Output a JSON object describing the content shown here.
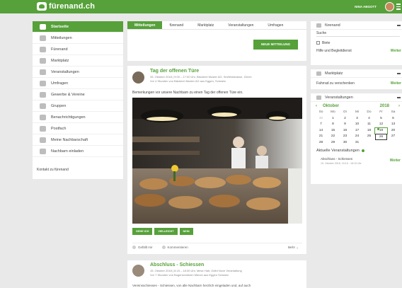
{
  "header": {
    "logo_text": "fürenand.ch",
    "user_name": "NINA ABGOTT"
  },
  "sidebar": {
    "items": [
      {
        "label": "Startseite",
        "icon": "home-icon",
        "active": true
      },
      {
        "label": "Mitteilungen",
        "icon": "speech-bubble-icon"
      },
      {
        "label": "Fürenand",
        "icon": "handshake-icon"
      },
      {
        "label": "Marktplatz",
        "icon": "tag-icon"
      },
      {
        "label": "Veranstaltungen",
        "icon": "calendar-icon"
      },
      {
        "label": "Umfragen",
        "icon": "poll-icon"
      },
      {
        "label": "Gewerbe & Vereine",
        "icon": "building-icon"
      },
      {
        "label": "Gruppen",
        "icon": "group-icon"
      },
      {
        "label": "Benachrichtigungen",
        "icon": "bell-icon"
      },
      {
        "label": "Postfach",
        "icon": "mail-icon"
      },
      {
        "label": "Meine Nachbarschaft",
        "icon": "house-icon"
      },
      {
        "label": "Nachbarn einladen",
        "icon": "invite-icon"
      }
    ],
    "contact": "Kontakt zu fürenand"
  },
  "composer": {
    "tabs": [
      "Mitteilungen",
      "fürenand",
      "Marktplatz",
      "Veranstaltungen",
      "Umfragen"
    ],
    "new_button": "NEUE MITTEILUNG"
  },
  "post1": {
    "title": "Tag der offenen Türe",
    "meta": "26. Oktober 2018 | 9:00 – 17:00 Uhr, Bäckerei Muster AG, Seefeldstrasse, Zürich",
    "meta2": "Vor 4 Stunden von Bäckerei Muster AG aus Eggen, Schweiz",
    "text": "Bemerkungen vor unsere Nachbarn zu einen Tag der offenen Türe ein.",
    "buttons": [
      "GEHE ICH",
      "VIELLEICHT",
      "NEIN"
    ],
    "like": "Gefällt mir",
    "comment": "Kommentieren",
    "more": "Mehr"
  },
  "post2": {
    "title": "Abschluss - Schiessen",
    "meta": "15. Oktober 2018 | 8:15 – 18:30 Uhr, Mese Halt, Gelbt Nove Verantaltung",
    "meta2": "Vor 7 Stunden von Bogenschützen Mönch aus Eggen Schweiz",
    "text": "Vereinsschiessen - Schiessen, von alle Nachbarn herzlich eingeladen und, auf auch"
  },
  "widget_fuerenand": {
    "title": "fürenand",
    "search_label": "Suche",
    "checkbox_label": "Biete",
    "footer_text": "Hilfe und Begleitdienst",
    "footer_link": "Weiter"
  },
  "widget_market": {
    "title": "Marktplatz",
    "row": "Fahrrad zu verschenken",
    "link": "Weiter"
  },
  "widget_events": {
    "title": "Veranstaltungen",
    "month": "Oktober",
    "year": "2018",
    "weekdays": [
      "So",
      "Mo",
      "Di",
      "Mi",
      "Do",
      "Fr",
      "Sa"
    ],
    "weeks": [
      [
        "30",
        "1",
        "2",
        "3",
        "4",
        "5",
        "6"
      ],
      [
        "7",
        "8",
        "9",
        "10",
        "11",
        "12",
        "13"
      ],
      [
        "14",
        "15",
        "16",
        "17",
        "18",
        "19",
        "20"
      ],
      [
        "21",
        "22",
        "23",
        "24",
        "25",
        "26",
        "27"
      ],
      [
        "28",
        "29",
        "30",
        "31",
        "",
        "",
        ""
      ]
    ],
    "current_title": "Aktuelle Veranstaltungen",
    "current_item": "Abschluss - Schiessen",
    "current_item_sub": "15. Oktober 2018, 15:15 - 18:15 Uhr",
    "current_link": "Weiter"
  },
  "colors": {
    "brand": "#56a13a"
  }
}
